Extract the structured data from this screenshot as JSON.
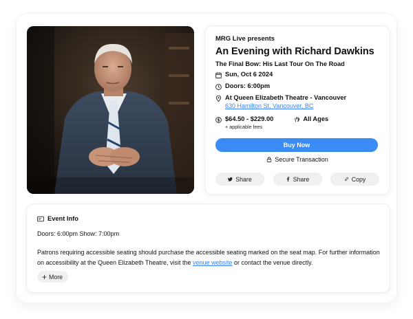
{
  "event": {
    "presenter": "MRG Live presents",
    "title": "An Evening with Richard Dawkins",
    "subtitle": "The Final Bow: His Last Tour On The Road",
    "date": "Sun, Oct 6 2024",
    "doors": "Doors: 6:00pm",
    "venue": "At Queen Elizabeth Theatre - Vancouver",
    "address": "630 Hamilton St, Vancouver, BC",
    "price": "$64.50 - $229.00",
    "fees": "+ applicable fees",
    "ages": "All Ages"
  },
  "actions": {
    "buy_label": "Buy Now",
    "secure_label": "Secure Transaction",
    "share_twitter": "Share",
    "share_facebook": "Share",
    "copy_label": "Copy"
  },
  "event_info": {
    "heading": "Event Info",
    "doors_show": "Doors: 6:00pm Show: 7:00pm",
    "access_before": "Patrons requiring accessible seating should purchase the accessible seating marked on the seat map. For further information on accessibility at the Queen Elizabeth Theatre, visit the ",
    "access_link": "venue website",
    "access_after": " or contact the venue directly.",
    "more_label": "More"
  },
  "colors": {
    "accent": "#3b8bf5",
    "link": "#3b82f6"
  },
  "icons": {
    "date": "calendar-icon",
    "doors": "clock-icon",
    "venue": "map-pin-icon",
    "price": "dollar-icon",
    "ages": "hand-icon",
    "secure": "lock-icon",
    "twitter": "twitter-icon",
    "facebook": "facebook-icon",
    "copy": "link-icon",
    "info": "ticket-icon"
  }
}
